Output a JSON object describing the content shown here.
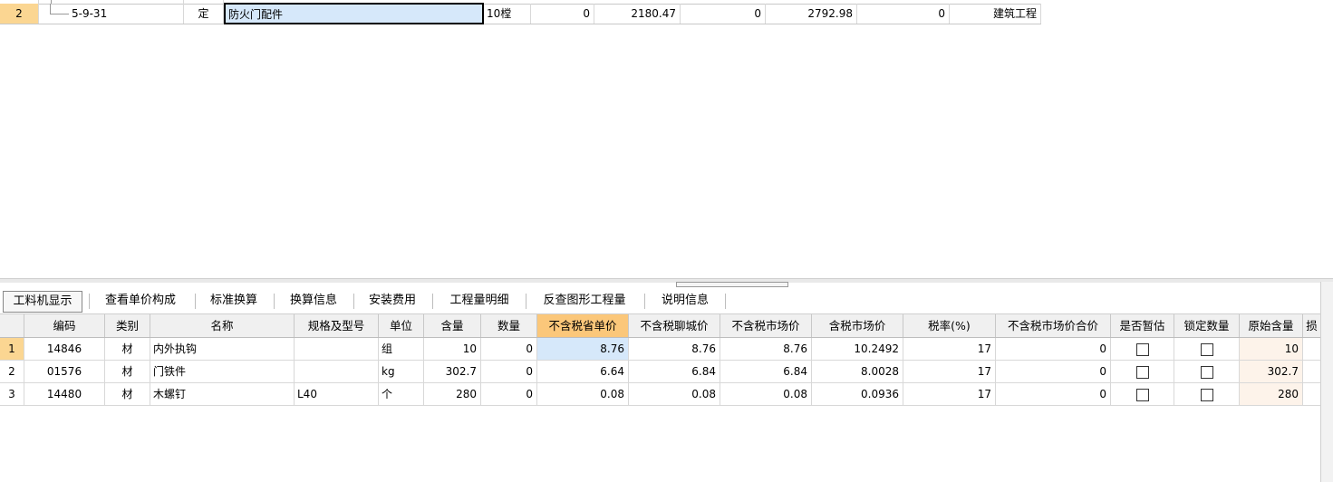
{
  "top_row": {
    "rownum": "2",
    "code": "5-9-31",
    "type": "定",
    "name": "防火门配件",
    "unit": "10樘",
    "v1": "0",
    "v2": "2180.47",
    "v3": "0",
    "v4": "2792.98",
    "v5": "0",
    "category": "建筑工程"
  },
  "tabs": [
    "工料机显示",
    "查看单价构成",
    "标准换算",
    "换算信息",
    "安装费用",
    "工程量明细",
    "反查图形工程量",
    "说明信息"
  ],
  "headers": [
    "编码",
    "类别",
    "名称",
    "规格及型号",
    "单位",
    "含量",
    "数量",
    "不含税省单价",
    "不含税聊城价",
    "不含税市场价",
    "含税市场价",
    "税率(%)",
    "不含税市场价合价",
    "是否暂估",
    "锁定数量",
    "原始含量",
    "损"
  ],
  "rows": [
    {
      "n": "1",
      "code": "14846",
      "type": "材",
      "name": "内外执钩",
      "spec": "",
      "unit": "组",
      "qty_per": "10",
      "qty": "0",
      "p1": "8.76",
      "p2": "8.76",
      "p3": "8.76",
      "p4": "10.2492",
      "tax": "17",
      "total": "0",
      "orig": "10"
    },
    {
      "n": "2",
      "code": "01576",
      "type": "材",
      "name": "门铁件",
      "spec": "",
      "unit": "kg",
      "qty_per": "302.7",
      "qty": "0",
      "p1": "6.64",
      "p2": "6.84",
      "p3": "6.84",
      "p4": "8.0028",
      "tax": "17",
      "total": "0",
      "orig": "302.7"
    },
    {
      "n": "3",
      "code": "14480",
      "type": "材",
      "name": "木螺钉",
      "spec": "L40",
      "unit": "个",
      "qty_per": "280",
      "qty": "0",
      "p1": "0.08",
      "p2": "0.08",
      "p3": "0.08",
      "p4": "0.0936",
      "tax": "17",
      "total": "0",
      "orig": "280"
    }
  ],
  "colors": {
    "row_header": "#fbd692",
    "highlight_header": "#fbc77a",
    "selection": "#d6e8fa"
  }
}
